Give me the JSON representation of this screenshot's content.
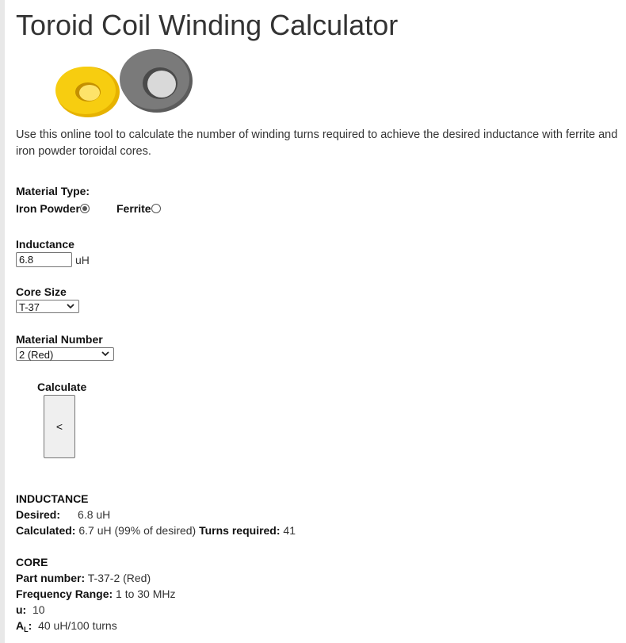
{
  "title": "Toroid Coil Winding Calculator",
  "intro": "Use this online tool to calculate the number of winding turns required to achieve the desired inductance with ferrite and iron powder toroidal cores.",
  "form": {
    "material_type_label": "Material Type:",
    "options": [
      {
        "label": "Iron Powder",
        "selected": true
      },
      {
        "label": "Ferrite",
        "selected": false
      }
    ],
    "inductance_label": "Inductance",
    "inductance_value": "6.8",
    "inductance_unit": "uH",
    "core_size_label": "Core Size",
    "core_size_value": "T-37",
    "material_number_label": "Material Number",
    "material_number_value": "2 (Red)",
    "calculate_label": "Calculate",
    "calculate_button": "<"
  },
  "results": {
    "inductance_heading": "INDUCTANCE",
    "desired_label": "Desired:",
    "desired_value": "6.8 uH",
    "calculated_label": "Calculated:",
    "calculated_value": "6.7 uH (99% of desired)",
    "turns_label": "Turns required:",
    "turns_value": "41",
    "core_heading": "CORE",
    "part_label": "Part number:",
    "part_value": "T-37-2 (Red)",
    "freq_label": "Frequency Range:",
    "freq_value": "1 to 30 MHz",
    "u_label": "u:",
    "u_value": "10",
    "al_label": "A",
    "al_sub": "L",
    "al_colon": ":",
    "al_value": "40 uH/100 turns"
  },
  "colors": {
    "yellow_core": "#f2c400",
    "gray_core": "#6f6f6f",
    "text": "#333333"
  },
  "icons": {
    "select_arrow": "chevron-down-icon",
    "radio": "radio-icon"
  }
}
